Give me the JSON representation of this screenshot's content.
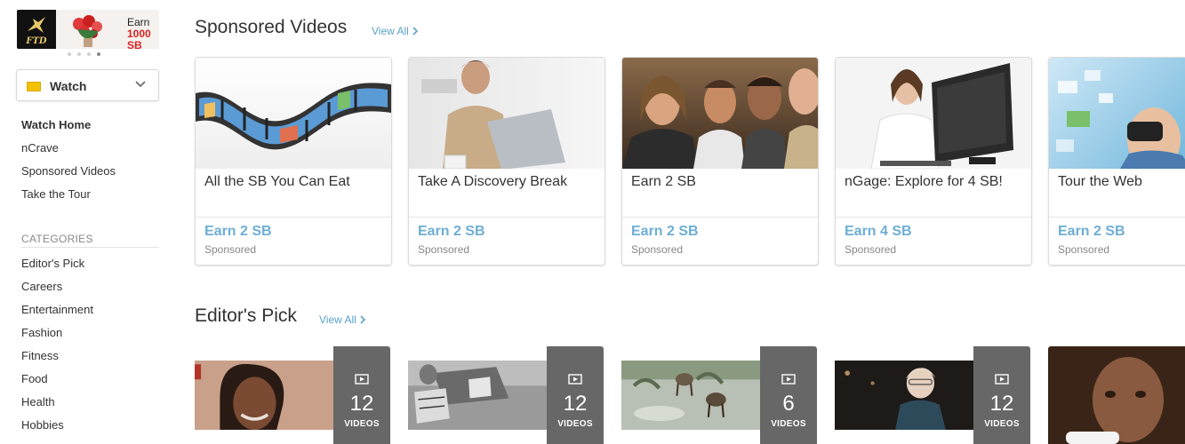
{
  "promo": {
    "earn_label": "Earn",
    "amount": "1000 SB",
    "brand": "FTD"
  },
  "watch_select": {
    "label": "Watch"
  },
  "nav": [
    "Watch Home",
    "nCrave",
    "Sponsored Videos",
    "Take the Tour"
  ],
  "categories": {
    "heading": "CATEGORIES",
    "items": [
      "Editor's Pick",
      "Careers",
      "Entertainment",
      "Fashion",
      "Fitness",
      "Food",
      "Health",
      "Hobbies"
    ]
  },
  "sponsored": {
    "title": "Sponsored Videos",
    "view_all": "View All",
    "cards": [
      {
        "title": "All the SB You Can Eat",
        "earn": "Earn 2 SB",
        "tag": "Sponsored"
      },
      {
        "title": "Take A Discovery Break",
        "earn": "Earn 2 SB",
        "tag": "Sponsored"
      },
      {
        "title": "Earn 2 SB",
        "earn": "Earn 2 SB",
        "tag": "Sponsored"
      },
      {
        "title": "nGage: Explore for 4 SB!",
        "earn": "Earn 4 SB",
        "tag": "Sponsored"
      },
      {
        "title": "Tour the Web",
        "earn": "Earn 2 SB",
        "tag": "Sponsored"
      }
    ]
  },
  "editors_pick": {
    "title": "Editor's Pick",
    "view_all": "View All",
    "playlists": [
      {
        "count": "12",
        "label": "VIDEOS"
      },
      {
        "count": "12",
        "label": "VIDEOS"
      },
      {
        "count": "6",
        "label": "VIDEOS"
      },
      {
        "count": "12",
        "label": "VIDEOS"
      },
      {
        "count": "",
        "label": ""
      }
    ]
  },
  "colors": {
    "accent": "#6eaed4",
    "link": "#5aa2c8",
    "promo_red": "#dd2222",
    "watch_icon": "#f2c200"
  },
  "icons": [
    "tv-icon",
    "chevron-down-icon",
    "chevron-right-icon",
    "video-play-icon"
  ]
}
